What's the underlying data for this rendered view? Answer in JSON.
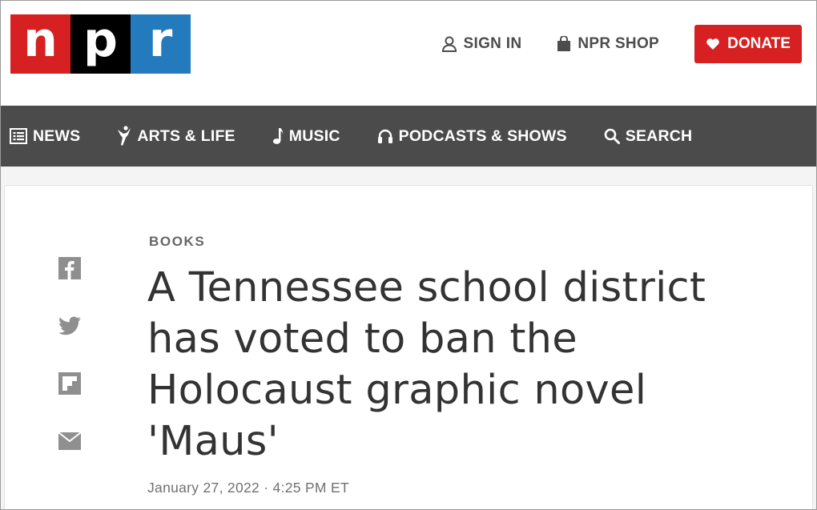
{
  "brand": {
    "letters": [
      "n",
      "p",
      "r"
    ],
    "colors": [
      "#d62021",
      "#000000",
      "#237bbd"
    ]
  },
  "utility": {
    "sign_in": "SIGN IN",
    "shop": "NPR SHOP",
    "donate": "DONATE",
    "donate_color": "#d62021"
  },
  "nav": {
    "background": "#4b4b4b",
    "items": [
      {
        "label": "NEWS",
        "icon": "news-icon"
      },
      {
        "label": "ARTS & LIFE",
        "icon": "arts-life-icon"
      },
      {
        "label": "MUSIC",
        "icon": "music-note-icon"
      },
      {
        "label": "PODCASTS & SHOWS",
        "icon": "headphones-icon"
      },
      {
        "label": "SEARCH",
        "icon": "search-icon"
      }
    ]
  },
  "share": [
    "facebook-icon",
    "twitter-icon",
    "flipboard-icon",
    "email-icon"
  ],
  "article": {
    "slug": "BOOKS",
    "headline_lines": [
      "A Tennessee school district",
      "has voted to ban the",
      "Holocaust graphic novel",
      "'Maus'"
    ],
    "date": "January 27, 2022",
    "separator": "·",
    "time": "4:25 PM ET"
  }
}
